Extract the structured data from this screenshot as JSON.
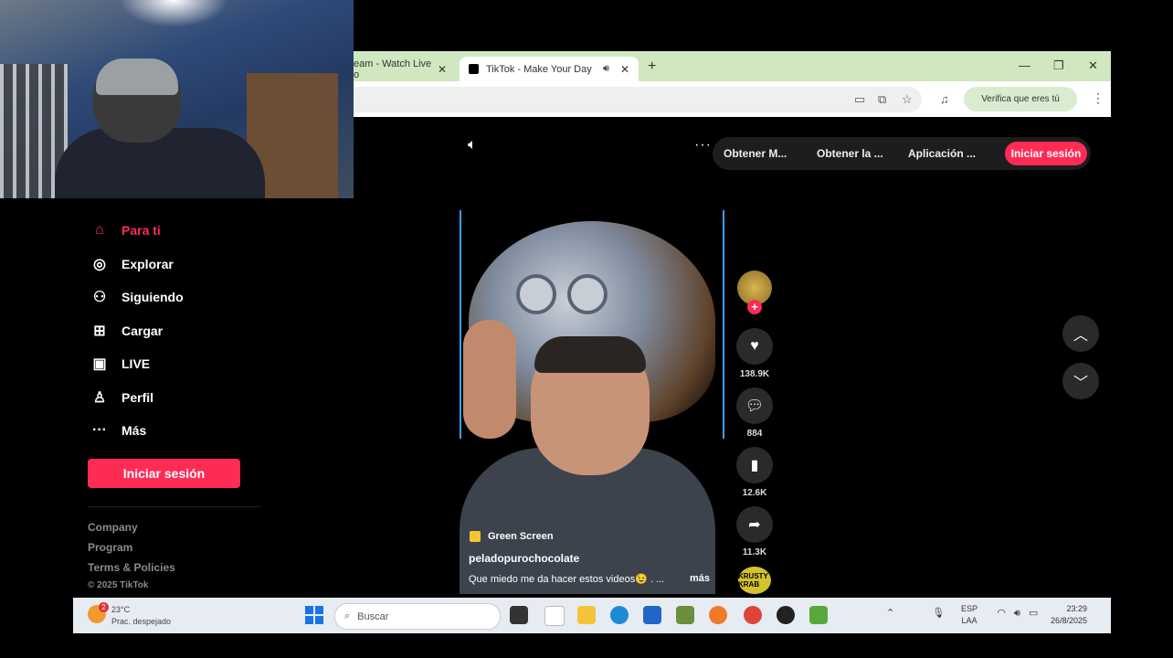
{
  "browser": {
    "tabs": [
      {
        "title": "eam - Watch Live o",
        "close": "✕"
      },
      {
        "title": "TikTok - Make Your Day",
        "close": "✕"
      }
    ],
    "new_tab": "+",
    "window_controls": [
      "—",
      "❐",
      "✕"
    ],
    "verify_label": "Verifica que eres tú",
    "icons": [
      "cast-icon",
      "translate-icon",
      "star-icon",
      "media-icon",
      "menu-icon"
    ]
  },
  "tiktok": {
    "top_menu": [
      "Obtener M...",
      "Obtener la ...",
      "Aplicación ..."
    ],
    "login_top": "Iniciar sesión",
    "sidebar": {
      "items": [
        {
          "label": "Para ti",
          "icon": "home-icon"
        },
        {
          "label": "Explorar",
          "icon": "compass-icon"
        },
        {
          "label": "Siguiendo",
          "icon": "following-icon"
        },
        {
          "label": "Cargar",
          "icon": "upload-icon"
        },
        {
          "label": "LIVE",
          "icon": "live-icon"
        },
        {
          "label": "Perfil",
          "icon": "profile-icon"
        },
        {
          "label": "Más",
          "icon": "more-icon"
        }
      ],
      "login_button": "Iniciar sesión",
      "footer": [
        "Company",
        "Program",
        "Terms & Policies"
      ],
      "copyright": "© 2025 TikTok"
    },
    "video": {
      "effect": "Green Screen",
      "username": "peladopurochocolate",
      "caption": "Que miedo me da hacer estos videos😉 . ...",
      "more": "más"
    },
    "actions": {
      "likes": "138.9K",
      "comments": "884",
      "saves": "12.6K",
      "shares": "11.3K",
      "music_label": "KRUSTY KRAB"
    },
    "accent": "#fe2c55"
  },
  "taskbar": {
    "temperature": "23°C",
    "weather": "Prac. despejado",
    "weather_badge": "2",
    "search_placeholder": "Buscar",
    "lang_top": "ESP",
    "lang_bottom": "LAA",
    "time": "23:29",
    "date": "26/8/2025"
  }
}
